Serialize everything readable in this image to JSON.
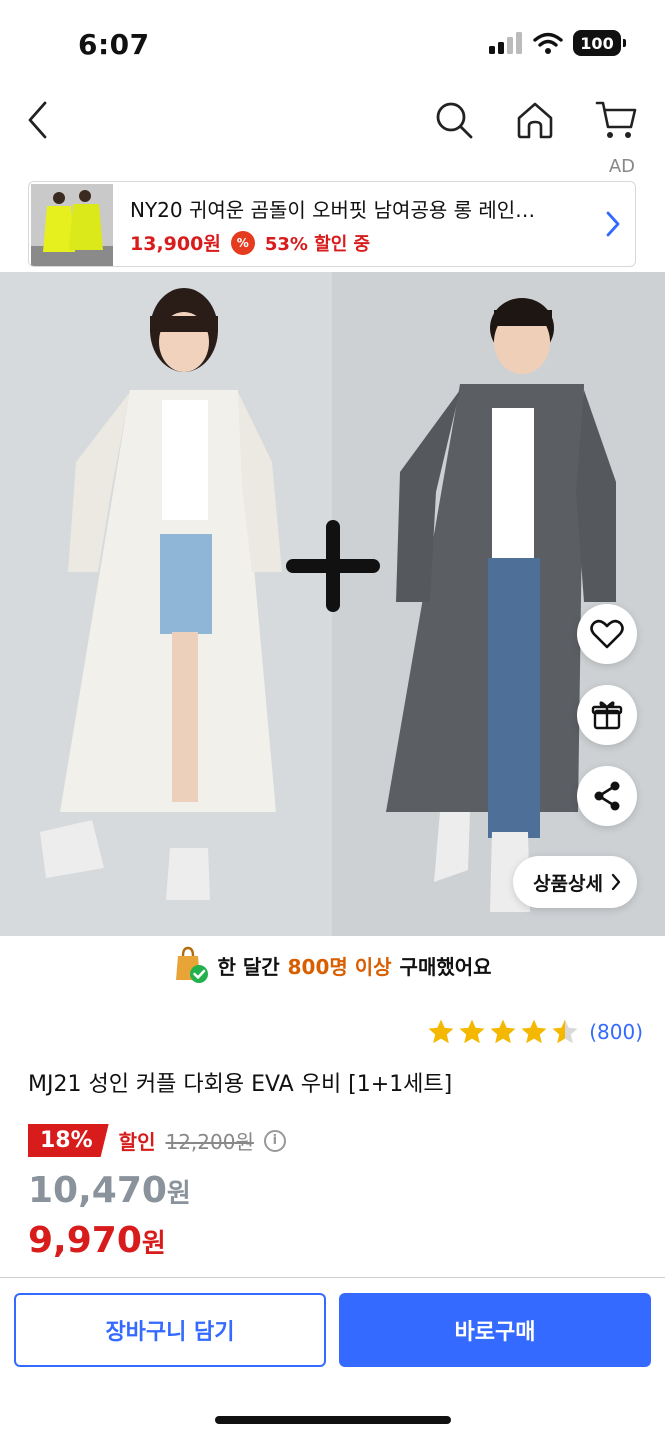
{
  "status_bar": {
    "time": "6:07",
    "battery": "100"
  },
  "ad": {
    "label": "AD",
    "title": "NY20 귀여운 곰돌이 오버핏 남여공용 롱 레인…",
    "price": "13,900원",
    "badge": "%",
    "discount": "53% 할인 중"
  },
  "purchase_info": {
    "prefix": "한 달간",
    "highlight": "800명 이상",
    "suffix": "구매했어요"
  },
  "rating": {
    "stars": 4.5,
    "max": 5,
    "count": "(800)"
  },
  "product": {
    "title": "MJ21 성인 커플 다회용 EVA 우비 [1+1세트]"
  },
  "price": {
    "discount_rate": "18%",
    "discount_label": "할인",
    "original": "12,200원",
    "info_icon": "i",
    "sale_value": "10,470",
    "sale_unit": "원",
    "final_value": "9,970",
    "final_unit": "원"
  },
  "image_overlay": {
    "plus_sign": "+",
    "detail_button": "상품상세"
  },
  "buttons": {
    "cart": "장바구니 담기",
    "buy": "바로구매"
  },
  "colors": {
    "accent_blue": "#346aff",
    "sale_red": "#d81b1b",
    "highlight_orange": "#d85e00",
    "star_gold": "#f5b800"
  }
}
